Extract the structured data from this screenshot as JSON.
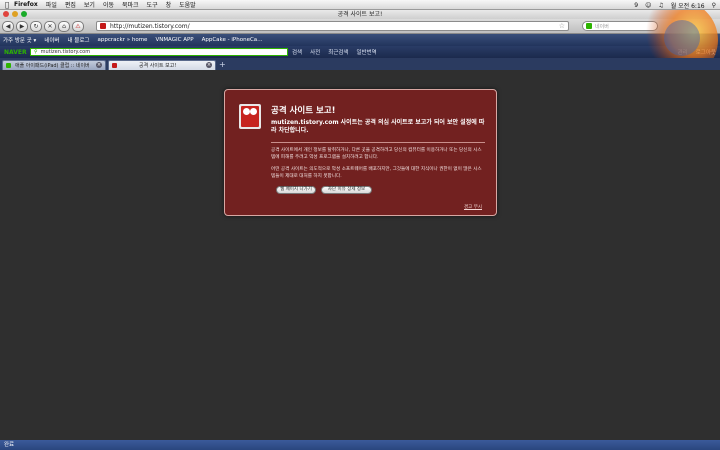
{
  "menubar": {
    "app": "Firefox",
    "items": [
      "파일",
      "편집",
      "보기",
      "이동",
      "북마크",
      "도구",
      "창",
      "도움말"
    ],
    "clock": "월 오전 6:16",
    "input_indicator": "9"
  },
  "window": {
    "title": "공격 사이트 보고!"
  },
  "toolbar": {
    "url": "http://mutizen.tistory.com/",
    "search_placeholder": "네이버"
  },
  "bookmarks": [
    "가주 방문 곳 ▾",
    "네이버",
    "내 블로그",
    "appcrackr » home",
    "VNMAGIC APP",
    "AppCake - iPhoneCa…"
  ],
  "naver_toolbar": {
    "logo": "NAVER",
    "query": "mutizen.tistory.com",
    "search_label": "검색",
    "items": [
      "사전",
      "최근검색",
      "일반번역"
    ],
    "right_items": [
      "관리",
      "로그아웃"
    ]
  },
  "tabs": [
    {
      "label": "애플 아이패드(iPad) 클럽 :: 네이버",
      "active": false
    },
    {
      "label": "공격 사이트 보고!",
      "active": true
    }
  ],
  "new_tab_label": "+",
  "dialog": {
    "title": "공격 사이트 보고!",
    "headline": "mutizen.tistory.com 사이트는 공격 의심 사이트로 보고가 되어 보안 설정에 따라 차단합니다.",
    "paragraph1": "공격 사이트에서 개인 정보를 탈취하거나, 다른 곳을 공격하려고 당신의 컴퓨터를 이용하거나 또는 당신의 시스템에 피해를 주려고 악성 프로그램을 설치하려고 합니다.",
    "paragraph2": "어떤 공격 사이트는 의도적으로 악성 소프트웨어를 배포하지만, 그것들에 대한 지식이나 권한이 없이 많은 시스템들이 제대로 대처를 하지 못합니다.",
    "button_leave": "웹 페이지 나가기",
    "button_details": "차단 이유 상세 정보",
    "ignore_link": "경고 무시"
  },
  "statusbar": {
    "text": "완료"
  },
  "colors": {
    "dialog_bg": "#722120",
    "content_bg": "#2f2f2f",
    "naver_green": "#2db400"
  }
}
